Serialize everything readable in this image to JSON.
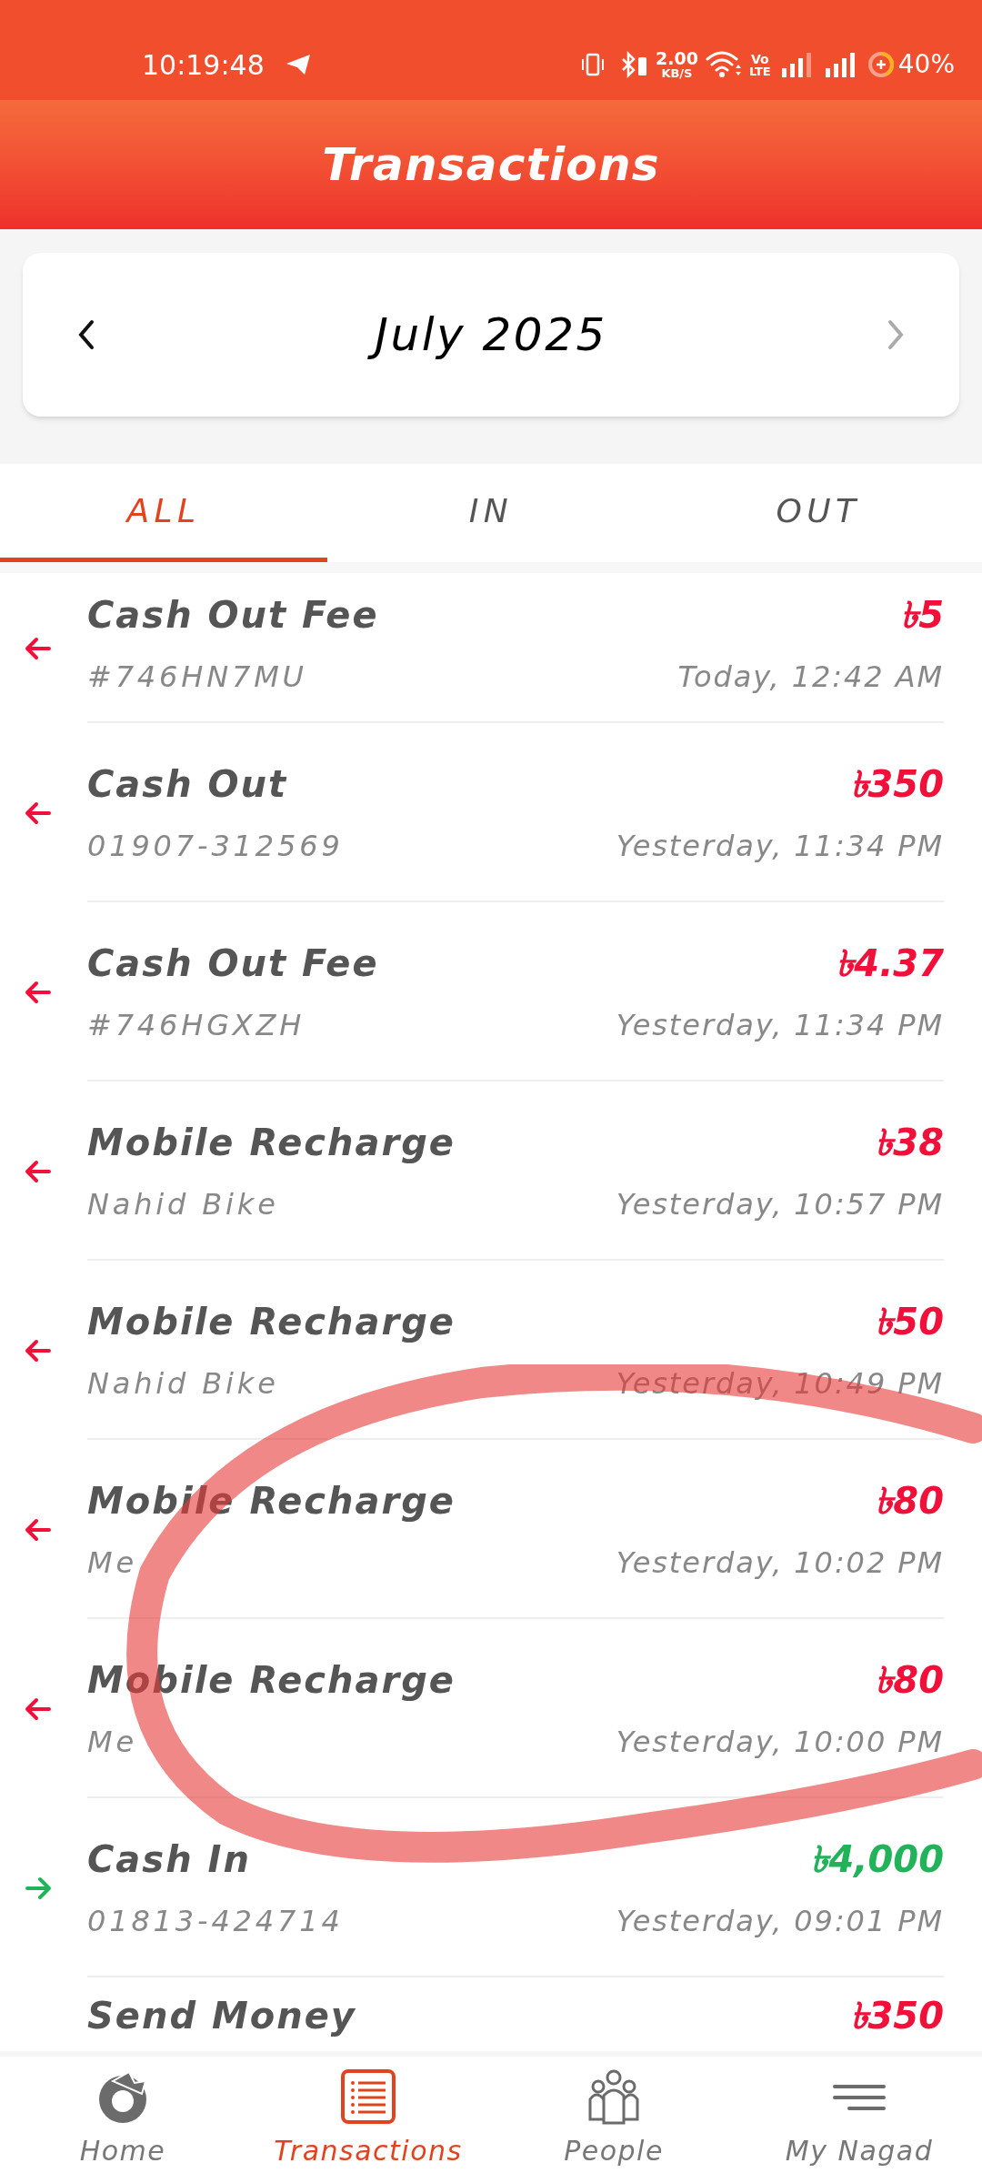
{
  "status_bar": {
    "time": "10:19:48",
    "speed": "2.00",
    "speed_unit": "KB/S",
    "volte_top": "Vo",
    "volte_bottom": "LTE",
    "battery": "40%"
  },
  "header": {
    "title": "Transactions"
  },
  "month_picker": {
    "label": "July 2025",
    "prev_disabled": false,
    "next_disabled": true
  },
  "tabs": [
    {
      "label": "ALL",
      "selected": true
    },
    {
      "label": "IN",
      "selected": false
    },
    {
      "label": "OUT",
      "selected": false
    }
  ],
  "transactions": [
    {
      "title": "Cash Out Fee",
      "subtitle": "#746HN7MU",
      "amount": "৳5",
      "time": "Today, 12:42 AM",
      "kind": "outgoing"
    },
    {
      "title": "Cash Out",
      "subtitle": "01907-312569",
      "amount": "৳350",
      "time": "Yesterday, 11:34 PM",
      "kind": "outgoing"
    },
    {
      "title": "Cash Out Fee",
      "subtitle": "#746HGXZH",
      "amount": "৳4.37",
      "time": "Yesterday, 11:34 PM",
      "kind": "outgoing"
    },
    {
      "title": "Mobile Recharge",
      "subtitle": "Nahid Bike",
      "amount": "৳38",
      "time": "Yesterday, 10:57 PM",
      "kind": "outgoing"
    },
    {
      "title": "Mobile Recharge",
      "subtitle": "Nahid Bike",
      "amount": "৳50",
      "time": "Yesterday, 10:49 PM",
      "kind": "outgoing"
    },
    {
      "title": "Mobile Recharge",
      "subtitle": "Me",
      "amount": "৳80",
      "time": "Yesterday, 10:02 PM",
      "kind": "outgoing"
    },
    {
      "title": "Mobile Recharge",
      "subtitle": "Me",
      "amount": "৳80",
      "time": "Yesterday, 10:00 PM",
      "kind": "outgoing"
    },
    {
      "title": "Cash In",
      "subtitle": "01813-424714",
      "amount": "৳4,000",
      "time": "Yesterday, 09:01 PM",
      "kind": "incoming"
    },
    {
      "title": "Send Money",
      "amount": "৳350",
      "kind": "outgoing"
    }
  ],
  "annotation": {
    "kind": "circle"
  },
  "bottom_nav": [
    {
      "label": "Home",
      "selected": false,
      "kind": "home"
    },
    {
      "label": "Transactions",
      "selected": true,
      "kind": "list"
    },
    {
      "label": "People",
      "selected": false,
      "kind": "people"
    },
    {
      "label": "My Nagad",
      "selected": false,
      "kind": "menu"
    }
  ]
}
